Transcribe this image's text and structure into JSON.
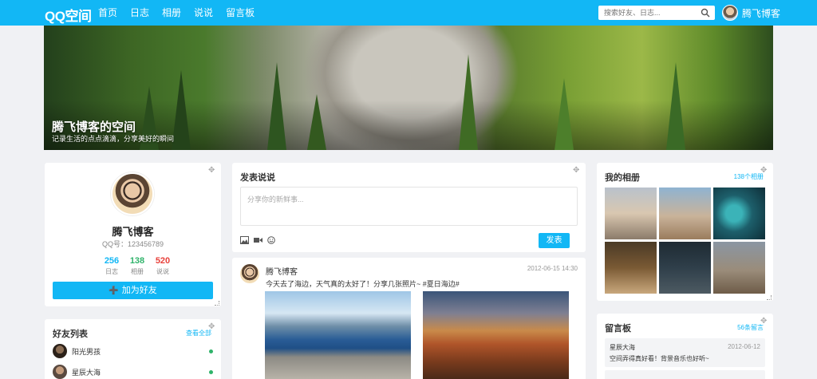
{
  "topbar": {
    "logo": "QQ空间",
    "nav": [
      "首页",
      "日志",
      "相册",
      "说说",
      "留言板"
    ],
    "search_placeholder": "搜索好友、日志...",
    "username": "腾飞博客"
  },
  "banner": {
    "title": "腾飞博客的空间",
    "subtitle": "记录生活的点点滴滴，分享美好的瞬间"
  },
  "profile": {
    "name": "腾飞博客",
    "qq": "QQ号：123456789",
    "stats": [
      {
        "value": "256",
        "label": "日志",
        "color": "#12b7f5"
      },
      {
        "value": "138",
        "label": "相册",
        "color": "#2fb36a"
      },
      {
        "value": "520",
        "label": "说说",
        "color": "#e8413b"
      }
    ],
    "add_friend": "加为好友"
  },
  "friends": {
    "title": "好友列表",
    "link": "查看全部",
    "items": [
      "阳光男孩",
      "星辰大海"
    ]
  },
  "composer": {
    "title": "发表说说",
    "placeholder": "分享你的新鲜事...",
    "submit": "发表"
  },
  "feed": {
    "author": "腾飞博客",
    "time": "2012-06-15 14:30",
    "text": "今天去了海边，天气真的太好了！分享几张照片~ #夏日海边#"
  },
  "albums": {
    "title": "我的相册",
    "link": "138个相册"
  },
  "messages": {
    "title": "留言板",
    "link": "56条留言",
    "items": [
      {
        "user": "星辰大海",
        "date": "2012-06-12",
        "text": "空间弄得真好看！背景音乐也好听~"
      }
    ]
  }
}
